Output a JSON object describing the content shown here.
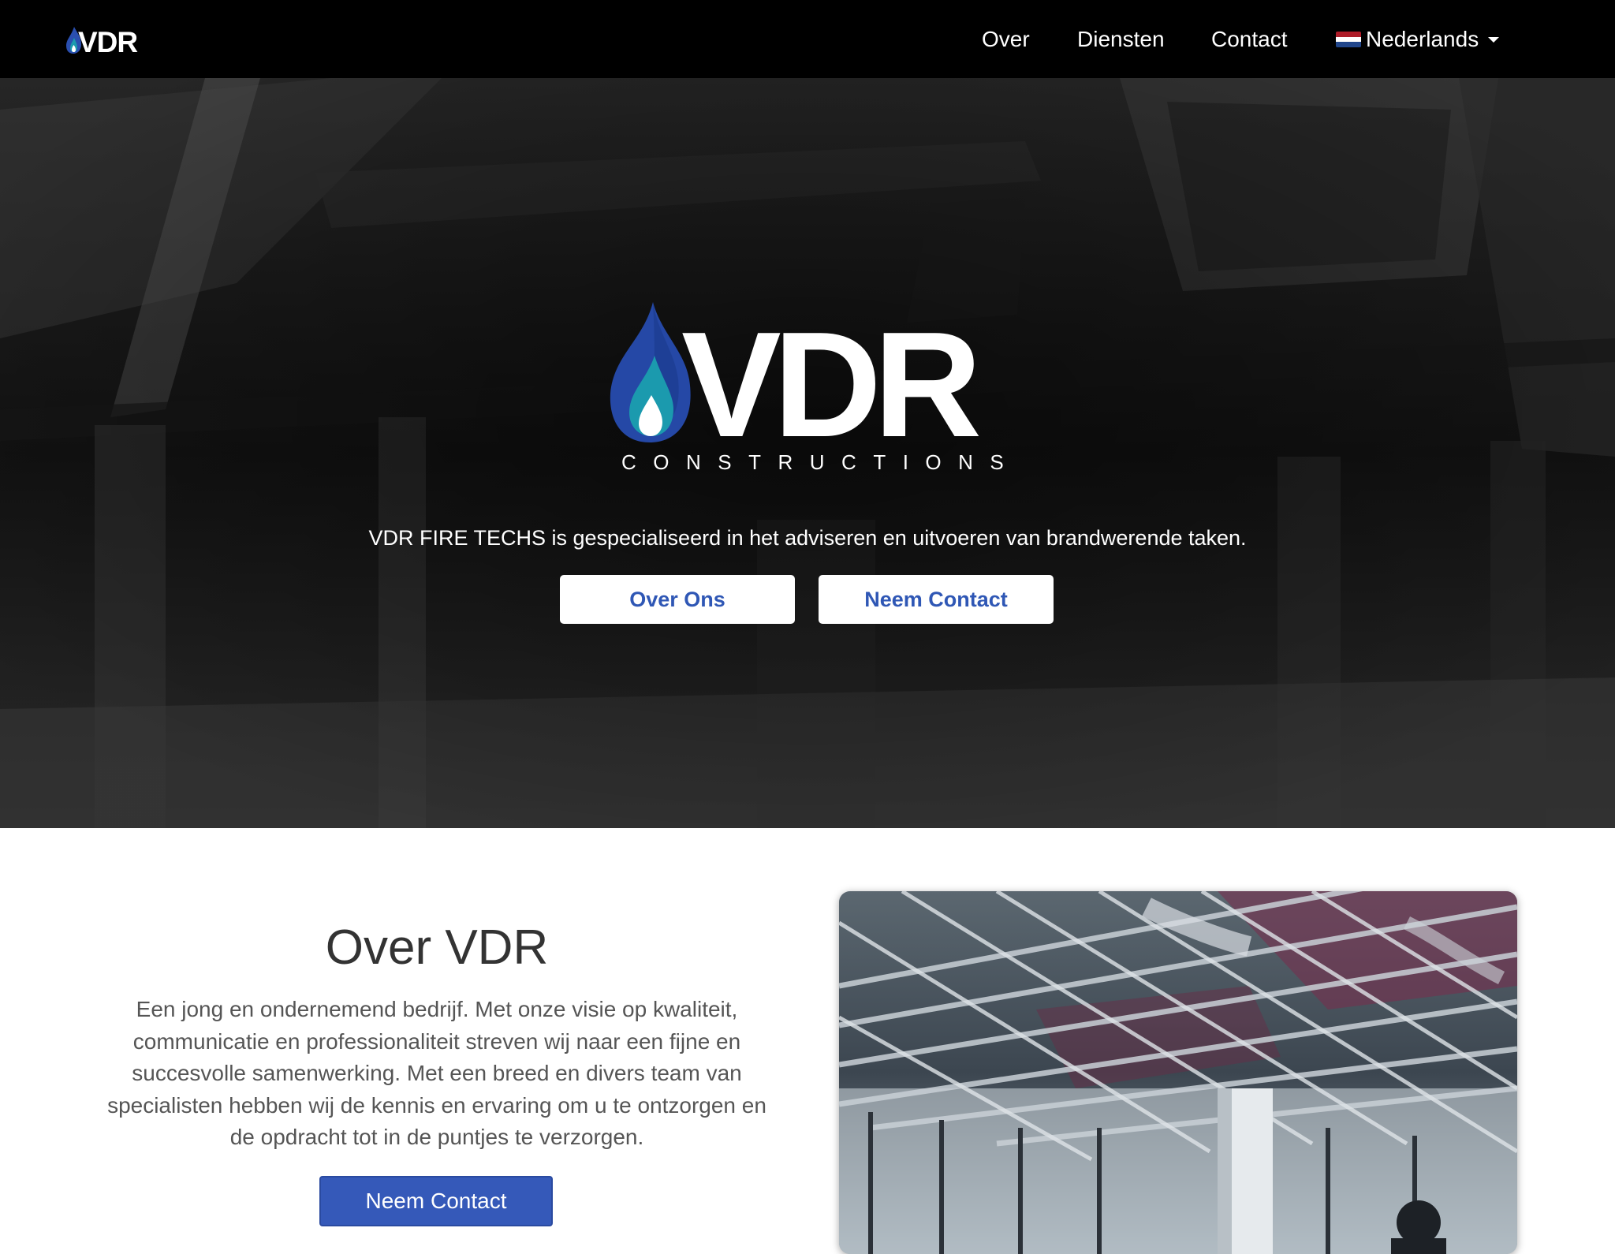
{
  "brand": {
    "logo_text": "VDR",
    "logo_subtext": "CONSTRUCTIONS"
  },
  "nav": {
    "links": [
      "Over",
      "Diensten",
      "Contact"
    ],
    "language": {
      "label": "Nederlands",
      "flag_icon": "netherlands-flag-icon"
    }
  },
  "hero": {
    "tagline": "VDR FIRE TECHS is gespecialiseerd in het adviseren en uitvoeren van brandwerende taken.",
    "buttons": [
      "Over Ons",
      "Neem Contact"
    ]
  },
  "about": {
    "title": "Over VDR",
    "text": "Een jong en ondernemend bedrijf. Met onze visie op kwaliteit, communicatie en professionaliteit streven wij naar een fijne en succesvolle samenwerking. Met een breed en divers team van specialisten hebben wij de kennis en ervaring om u te ontzorgen en de opdracht tot in de puntjes te verzorgen.",
    "button": "Neem Contact"
  },
  "colors": {
    "navbar": "#000000",
    "accent_blue": "#2f57b5",
    "button_blue": "#3559b9",
    "flame_dark": "#1f3f95",
    "flame_teal": "#1b9aae"
  }
}
